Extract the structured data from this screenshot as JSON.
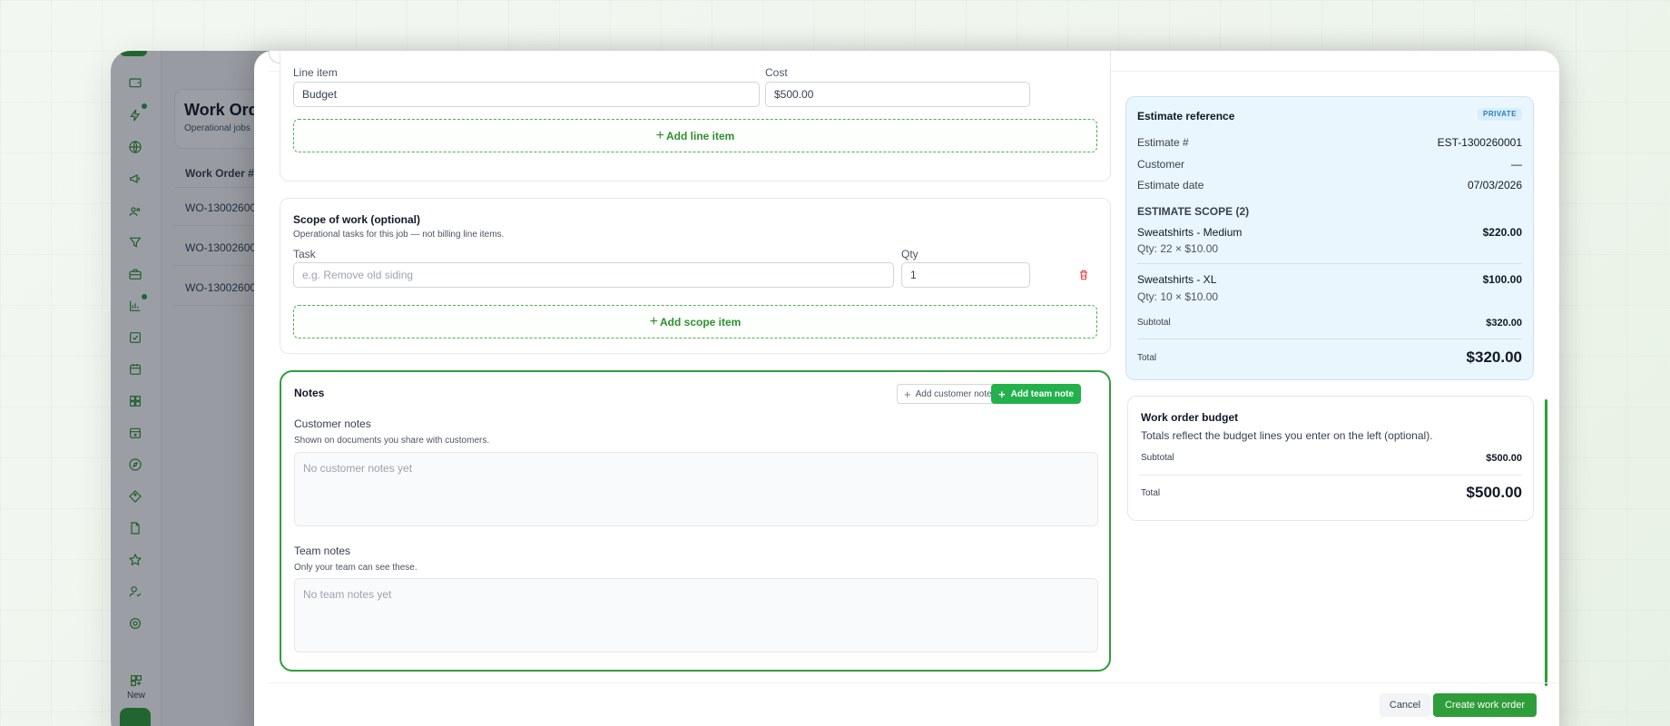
{
  "background_page": {
    "title": "Work Ord",
    "subtitle": "Operational jobs",
    "table_header": "Work Order #",
    "rows": [
      "WO-13002600",
      "WO-13002600",
      "WO-13002600"
    ],
    "new_label": "New"
  },
  "line_items": {
    "line_item_label": "Line item",
    "cost_label": "Cost",
    "line_item_value": "Budget",
    "cost_value": "$500.00",
    "add_button": "Add line item"
  },
  "scope": {
    "title": "Scope of work (optional)",
    "description": "Operational tasks for this job — not billing line items.",
    "task_label": "Task",
    "qty_label": "Qty",
    "task_placeholder": "e.g. Remove old siding",
    "qty_value": "1",
    "add_button": "Add scope item"
  },
  "notes": {
    "title": "Notes",
    "add_customer_note": "Add customer note",
    "add_team_note": "Add team note",
    "customer_label": "Customer notes",
    "customer_help": "Shown on documents you share with customers.",
    "customer_empty": "No customer notes yet",
    "team_label": "Team notes",
    "team_help": "Only your team can see these.",
    "team_empty": "No team notes yet"
  },
  "estimate": {
    "title": "Estimate reference",
    "badge": "PRIVATE",
    "estimate_no_label": "Estimate #",
    "estimate_no_value": "EST-1300260001",
    "customer_label": "Customer",
    "customer_value": "—",
    "date_label": "Estimate date",
    "date_value": "07/03/2026",
    "scope_heading": "ESTIMATE SCOPE (2)",
    "items": [
      {
        "name": "Sweatshirts - Medium",
        "value": "$220.00",
        "qty": "Qty: 22 × $10.00"
      },
      {
        "name": "Sweatshirts - XL",
        "value": "$100.00",
        "qty": "Qty: 10 × $10.00"
      }
    ],
    "subtotal_label": "Subtotal",
    "subtotal_value": "$320.00",
    "total_label": "Total",
    "total_value": "$320.00"
  },
  "budget": {
    "title": "Work order budget",
    "description": "Totals reflect the budget lines you enter on the left (optional).",
    "subtotal_label": "Subtotal",
    "subtotal_value": "$500.00",
    "total_label": "Total",
    "total_value": "$500.00"
  },
  "footer": {
    "cancel": "Cancel",
    "create": "Create work order"
  },
  "colors": {
    "brand_green": "#2f9e3a",
    "team_note_green": "#22b14c",
    "estimate_bg": "#eaf6fd",
    "danger": "#e5484d"
  }
}
